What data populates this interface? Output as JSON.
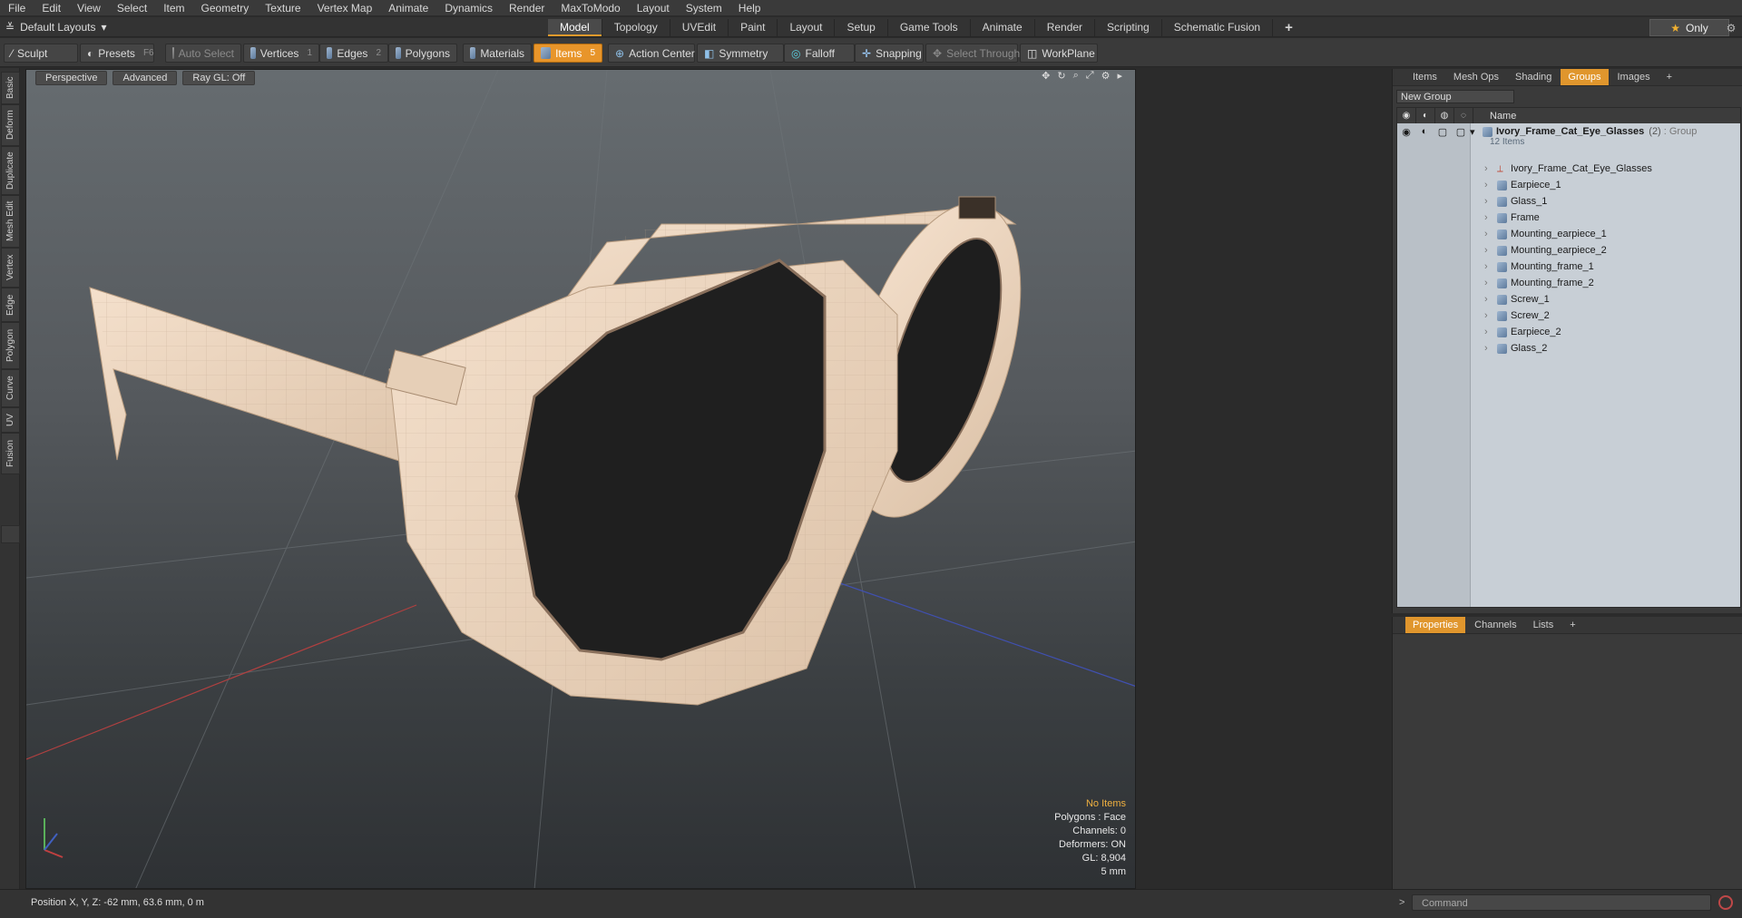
{
  "menu": [
    "File",
    "Edit",
    "View",
    "Select",
    "Item",
    "Geometry",
    "Texture",
    "Vertex Map",
    "Animate",
    "Dynamics",
    "Render",
    "MaxToModo",
    "Layout",
    "System",
    "Help"
  ],
  "layout": {
    "name": "Default Layouts"
  },
  "tabs": [
    "Model",
    "Topology",
    "UVEdit",
    "Paint",
    "Layout",
    "Setup",
    "Game Tools",
    "Animate",
    "Render",
    "Scripting",
    "Schematic Fusion",
    "+"
  ],
  "only_label": "Only",
  "toolbar": {
    "sculpt": "Sculpt",
    "presets": "Presets",
    "presets_key": "F6",
    "auto_select": "Auto Select",
    "vertices": "Vertices",
    "vertices_key": "1",
    "edges": "Edges",
    "edges_key": "2",
    "polygons": "Polygons",
    "materials": "Materials",
    "items": "Items",
    "items_key": "5",
    "action_center": "Action Center",
    "symmetry": "Symmetry",
    "falloff": "Falloff",
    "snapping": "Snapping",
    "select_through": "Select Through",
    "workplane": "WorkPlane"
  },
  "left_tabs": [
    "Basic",
    "Deform",
    "Duplicate",
    "Mesh Edit",
    "Vertex",
    "Edge",
    "Polygon",
    "Curve",
    "UV",
    "Fusion"
  ],
  "viewport": {
    "perspective": "Perspective",
    "advanced": "Advanced",
    "raygl": "Ray GL: Off",
    "info": {
      "items": "No Items",
      "polygons": "Polygons : Face",
      "channels": "Channels: 0",
      "deformers": "Deformers: ON",
      "gl": "GL: 8,904",
      "scale": "5 mm"
    }
  },
  "status": {
    "position": "Position X, Y, Z:  -62 mm, 63.6 mm, 0 m",
    "command_placeholder": "Command"
  },
  "right_panel": {
    "tabs": [
      "Items",
      "Mesh Ops",
      "Shading",
      "Groups",
      "Images",
      "+"
    ],
    "active_tab": "Groups",
    "new_group": "New Group",
    "name_col": "Name",
    "group": {
      "name": "Ivory_Frame_Cat_Eye_Glasses",
      "count": "(2)",
      "type": ": Group",
      "items_count": "12 Items"
    },
    "items": [
      "Ivory_Frame_Cat_Eye_Glasses",
      "Earpiece_1",
      "Glass_1",
      "Frame",
      "Mounting_earpiece_1",
      "Mounting_earpiece_2",
      "Mounting_frame_1",
      "Mounting_frame_2",
      "Screw_1",
      "Screw_2",
      "Earpiece_2",
      "Glass_2"
    ],
    "bottom_tabs": [
      "Properties",
      "Channels",
      "Lists",
      "+"
    ]
  }
}
